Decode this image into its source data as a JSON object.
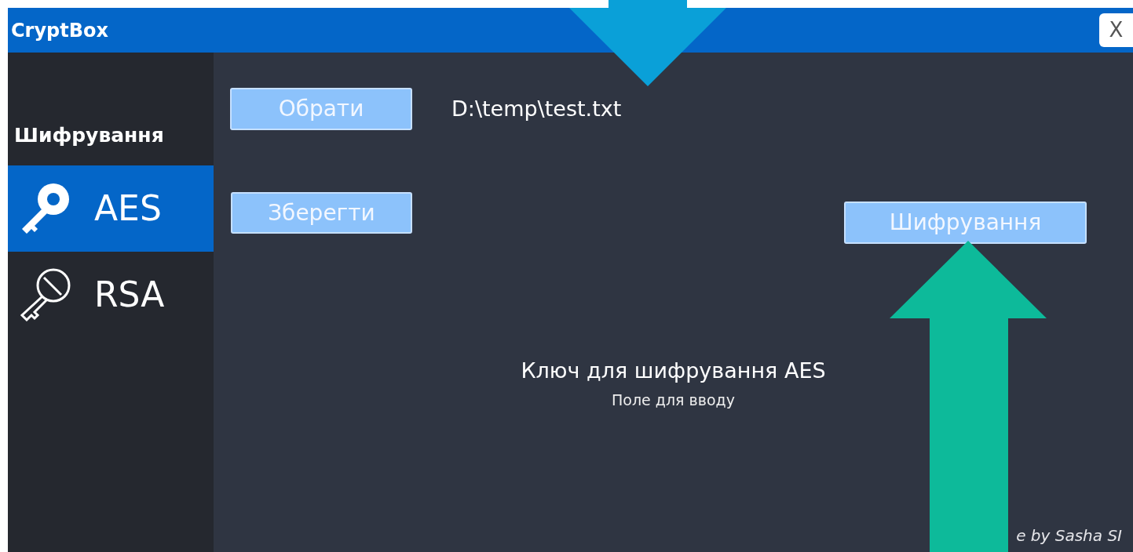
{
  "window": {
    "title": "CryptBox",
    "close": "X"
  },
  "sidebar": {
    "heading": "Шифрування",
    "items": [
      {
        "label": "AES",
        "selected": true
      },
      {
        "label": "RSA",
        "selected": false
      }
    ]
  },
  "main": {
    "open_button": "Обрати",
    "file_path": "D:\\temp\\test.txt",
    "save_button": "Зберегти",
    "encrypt_button": "Шифрування",
    "key_label": "Ключ для шифрування AES",
    "key_field": {
      "placeholder": "Поле для вводу"
    },
    "footer": "e by Sasha SI"
  }
}
